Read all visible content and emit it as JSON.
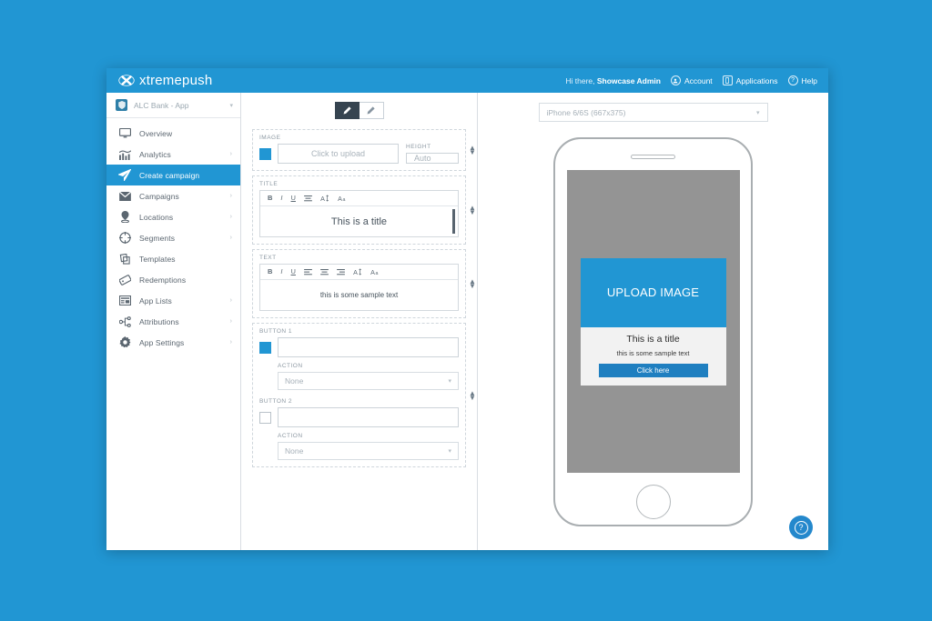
{
  "brand": {
    "name": "xtremepush",
    "mark": "x-logo-icon"
  },
  "header": {
    "greeting_prefix": "Hi there, ",
    "user": "Showcase Admin",
    "items": [
      {
        "label": "Account",
        "icon": "user-icon"
      },
      {
        "label": "Applications",
        "icon": "mobile-icon"
      },
      {
        "label": "Help",
        "icon": "question-icon"
      }
    ]
  },
  "sidebar": {
    "app_selector": {
      "label": "ALC Bank - App",
      "caret": "chevron-down-icon"
    },
    "items": [
      {
        "label": "Overview",
        "icon": "monitor-icon",
        "arrow": false,
        "active": false
      },
      {
        "label": "Analytics",
        "icon": "chart-icon",
        "arrow": true,
        "active": false
      },
      {
        "label": "Create campaign",
        "icon": "paper-plane-icon",
        "arrow": false,
        "active": true
      },
      {
        "label": "Campaigns",
        "icon": "envelope-icon",
        "arrow": true,
        "active": false
      },
      {
        "label": "Locations",
        "icon": "map-pin-icon",
        "arrow": true,
        "active": false
      },
      {
        "label": "Segments",
        "icon": "target-icon",
        "arrow": true,
        "active": false
      },
      {
        "label": "Templates",
        "icon": "layers-icon",
        "arrow": false,
        "active": false
      },
      {
        "label": "Redemptions",
        "icon": "ticket-icon",
        "arrow": false,
        "active": false
      },
      {
        "label": "App Lists",
        "icon": "list-icon",
        "arrow": true,
        "active": false
      },
      {
        "label": "Attributions",
        "icon": "sitemap-icon",
        "arrow": true,
        "active": false
      },
      {
        "label": "App Settings",
        "icon": "gear-icon",
        "arrow": true,
        "active": false
      }
    ]
  },
  "editor": {
    "mode_toggle": [
      {
        "icon": "pencil-filled-icon",
        "active": true
      },
      {
        "icon": "pencil-outline-icon",
        "active": false
      }
    ],
    "image_block": {
      "label": "IMAGE",
      "checkbox_checked": true,
      "upload_placeholder": "Click to upload",
      "height_label": "HEIGHT",
      "height_value": "Auto"
    },
    "title_block": {
      "label": "TITLE",
      "toolbar": [
        "B",
        "I",
        "U",
        "align-center-icon",
        "font-size-icon",
        "font-family-icon"
      ],
      "value": "This is a title"
    },
    "text_block": {
      "label": "TEXT",
      "toolbar": [
        "B",
        "I",
        "U",
        "align-left-icon",
        "align-center-icon",
        "align-right-icon",
        "font-size-icon",
        "font-family-icon"
      ],
      "value": "this is some sample text"
    },
    "button1": {
      "label": "BUTTON 1",
      "checkbox_checked": true,
      "value": "",
      "action_label": "ACTION",
      "action_value": "None"
    },
    "button2": {
      "label": "BUTTON 2",
      "checkbox_checked": false,
      "value": "",
      "action_label": "ACTION",
      "action_value": "None"
    }
  },
  "preview": {
    "device": "iPhone 6/6S (667x375)",
    "card": {
      "image_placeholder": "UPLOAD IMAGE",
      "title": "This is a title",
      "text": "this is some sample text",
      "button": "Click here"
    }
  },
  "help_fab": {
    "icon": "question-icon",
    "label": "?"
  },
  "colors": {
    "brand_blue": "#2196d3",
    "page_background": "#2196d3",
    "active_nav": "#2196d3",
    "toggle_active": "#364450",
    "card_button": "#1f7fc0",
    "screen_gray": "#949494"
  }
}
